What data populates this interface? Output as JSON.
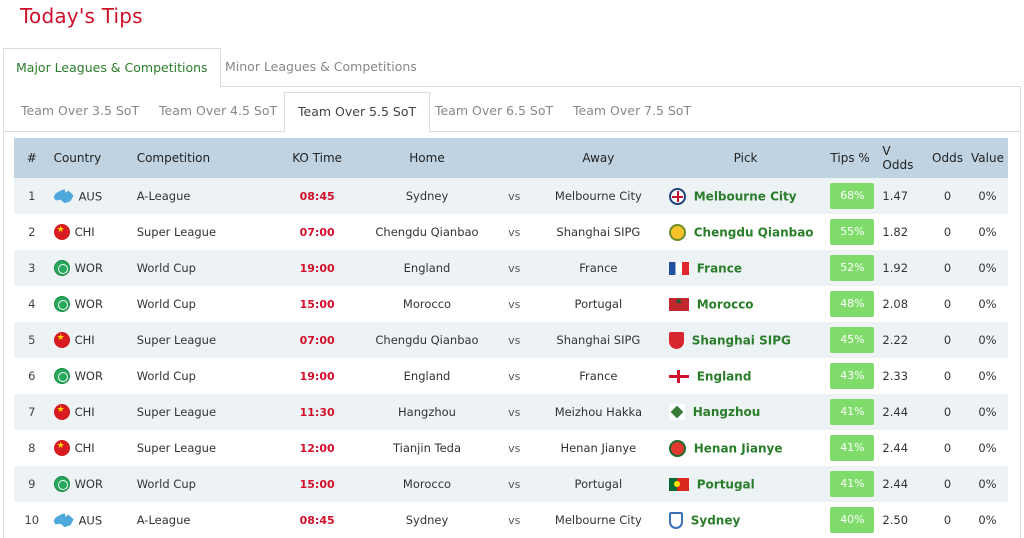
{
  "page": {
    "title": "Today's Tips"
  },
  "outer_tabs": [
    {
      "label": "Major Leagues & Competitions",
      "active": true
    },
    {
      "label": "Minor Leagues & Competitions",
      "active": false
    }
  ],
  "inner_tabs": [
    {
      "label": "Team Over 3.5 SoT",
      "active": false
    },
    {
      "label": "Team Over 4.5 SoT",
      "active": false
    },
    {
      "label": "Team Over 5.5 SoT",
      "active": true
    },
    {
      "label": "Team Over 6.5 SoT",
      "active": false
    },
    {
      "label": "Team Over 7.5 SoT",
      "active": false
    }
  ],
  "table": {
    "headers": {
      "num": "#",
      "country": "Country",
      "competition": "Competition",
      "ko_time": "KO Time",
      "home": "Home",
      "away": "Away",
      "pick": "Pick",
      "tips_pct": "Tips %",
      "v_odds": "V Odds",
      "odds": "Odds",
      "value": "Value"
    },
    "vs_label": "vs",
    "rows": [
      {
        "num": "1",
        "country_code": "AUS",
        "country_icon": "australia-flag-icon",
        "competition": "A-League",
        "ko_time": "08:45",
        "home": "Sydney",
        "away": "Melbourne City",
        "pick": "Melbourne City",
        "pick_icon": "melbourne-city-crest-icon",
        "tips_pct": "68%",
        "v_odds": "1.47",
        "odds": "0",
        "value": "0%"
      },
      {
        "num": "2",
        "country_code": "CHI",
        "country_icon": "china-flag-icon",
        "competition": "Super League",
        "ko_time": "07:00",
        "home": "Chengdu Qianbao",
        "away": "Shanghai SIPG",
        "pick": "Chengdu Qianbao",
        "pick_icon": "chengdu-qianbao-crest-icon",
        "tips_pct": "55%",
        "v_odds": "1.82",
        "odds": "0",
        "value": "0%"
      },
      {
        "num": "3",
        "country_code": "WOR",
        "country_icon": "world-globe-icon",
        "competition": "World Cup",
        "ko_time": "19:00",
        "home": "England",
        "away": "France",
        "pick": "France",
        "pick_icon": "france-flag-icon",
        "tips_pct": "52%",
        "v_odds": "1.92",
        "odds": "0",
        "value": "0%"
      },
      {
        "num": "4",
        "country_code": "WOR",
        "country_icon": "world-globe-icon",
        "competition": "World Cup",
        "ko_time": "15:00",
        "home": "Morocco",
        "away": "Portugal",
        "pick": "Morocco",
        "pick_icon": "morocco-flag-icon",
        "tips_pct": "48%",
        "v_odds": "2.08",
        "odds": "0",
        "value": "0%"
      },
      {
        "num": "5",
        "country_code": "CHI",
        "country_icon": "china-flag-icon",
        "competition": "Super League",
        "ko_time": "07:00",
        "home": "Chengdu Qianbao",
        "away": "Shanghai SIPG",
        "pick": "Shanghai SIPG",
        "pick_icon": "shanghai-sipg-crest-icon",
        "tips_pct": "45%",
        "v_odds": "2.22",
        "odds": "0",
        "value": "0%"
      },
      {
        "num": "6",
        "country_code": "WOR",
        "country_icon": "world-globe-icon",
        "competition": "World Cup",
        "ko_time": "19:00",
        "home": "England",
        "away": "France",
        "pick": "England",
        "pick_icon": "england-flag-icon",
        "tips_pct": "43%",
        "v_odds": "2.33",
        "odds": "0",
        "value": "0%"
      },
      {
        "num": "7",
        "country_code": "CHI",
        "country_icon": "china-flag-icon",
        "competition": "Super League",
        "ko_time": "11:30",
        "home": "Hangzhou",
        "away": "Meizhou Hakka",
        "pick": "Hangzhou",
        "pick_icon": "hangzhou-crest-icon",
        "tips_pct": "41%",
        "v_odds": "2.44",
        "odds": "0",
        "value": "0%"
      },
      {
        "num": "8",
        "country_code": "CHI",
        "country_icon": "china-flag-icon",
        "competition": "Super League",
        "ko_time": "12:00",
        "home": "Tianjin Teda",
        "away": "Henan Jianye",
        "pick": "Henan Jianye",
        "pick_icon": "henan-jianye-crest-icon",
        "tips_pct": "41%",
        "v_odds": "2.44",
        "odds": "0",
        "value": "0%"
      },
      {
        "num": "9",
        "country_code": "WOR",
        "country_icon": "world-globe-icon",
        "competition": "World Cup",
        "ko_time": "15:00",
        "home": "Morocco",
        "away": "Portugal",
        "pick": "Portugal",
        "pick_icon": "portugal-flag-icon",
        "tips_pct": "41%",
        "v_odds": "2.44",
        "odds": "0",
        "value": "0%"
      },
      {
        "num": "10",
        "country_code": "AUS",
        "country_icon": "australia-flag-icon",
        "competition": "A-League",
        "ko_time": "08:45",
        "home": "Sydney",
        "away": "Melbourne City",
        "pick": "Sydney",
        "pick_icon": "sydney-fc-crest-icon",
        "tips_pct": "40%",
        "v_odds": "2.50",
        "odds": "0",
        "value": "0%"
      }
    ]
  },
  "colors": {
    "title_red": "#d0102a",
    "active_tab_green": "#2a7d2a",
    "header_bg": "#bfd3e2",
    "stripe_bg": "#edf2f5",
    "ko_time_red": "#d0102a",
    "pick_green": "#2a7d2a",
    "tips_badge_green": "#7fdc6a"
  }
}
